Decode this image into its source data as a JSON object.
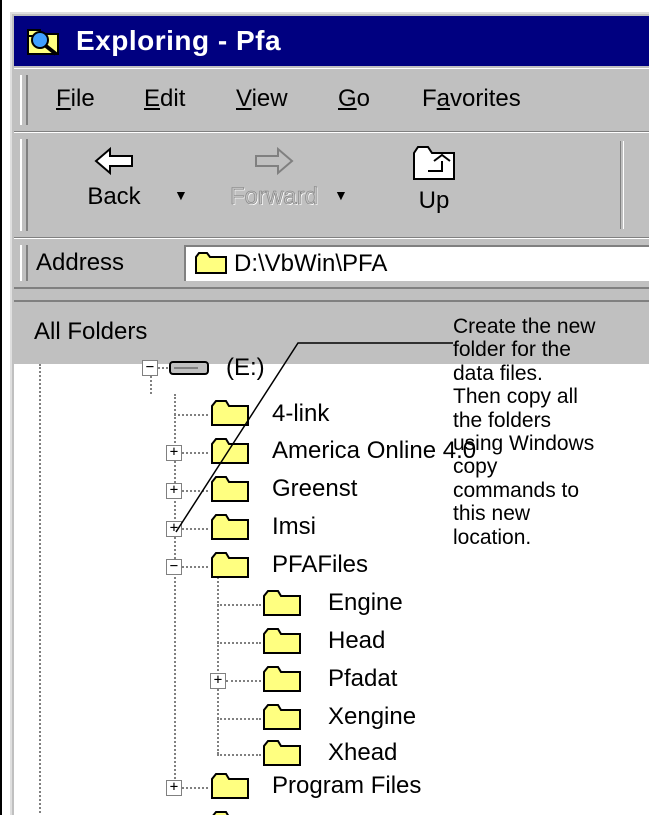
{
  "window": {
    "title": "Exploring - Pfa"
  },
  "menu": [
    {
      "pre": "",
      "u": "F",
      "post": "ile"
    },
    {
      "pre": "",
      "u": "E",
      "post": "dit"
    },
    {
      "pre": "",
      "u": "V",
      "post": "iew"
    },
    {
      "pre": "",
      "u": "G",
      "post": "o"
    },
    {
      "pre": "F",
      "u": "a",
      "post": "vorites"
    }
  ],
  "toolbar": {
    "back": "Back",
    "forward": "Forward",
    "up": "Up"
  },
  "address": {
    "label": "Address",
    "value": "D:\\VbWin\\PFA"
  },
  "pane": {
    "header": "All Folders"
  },
  "tree": {
    "drive": "(E:)",
    "items": [
      "4-link",
      "America Online 4.0",
      "Greenst",
      "Imsi",
      "PFAFiles",
      "Engine",
      "Head",
      "Pfadat",
      "Xengine",
      "Xhead",
      "Program Files"
    ]
  },
  "annotation": {
    "lines": [
      "Create the new",
      "folder for the",
      "data files.",
      "Then copy all",
      "the folders",
      "using Windows",
      "copy",
      "commands to",
      "this new",
      "location."
    ]
  },
  "colors": {
    "titlebar": "#000080",
    "face": "#c0c0c0",
    "folder": "#ffff80"
  },
  "icons": {
    "title": "explorer-icon",
    "back": "back-arrow-icon",
    "forward": "forward-arrow-icon",
    "up": "up-folder-icon",
    "drive": "drive-icon",
    "folder": "folder-icon"
  }
}
